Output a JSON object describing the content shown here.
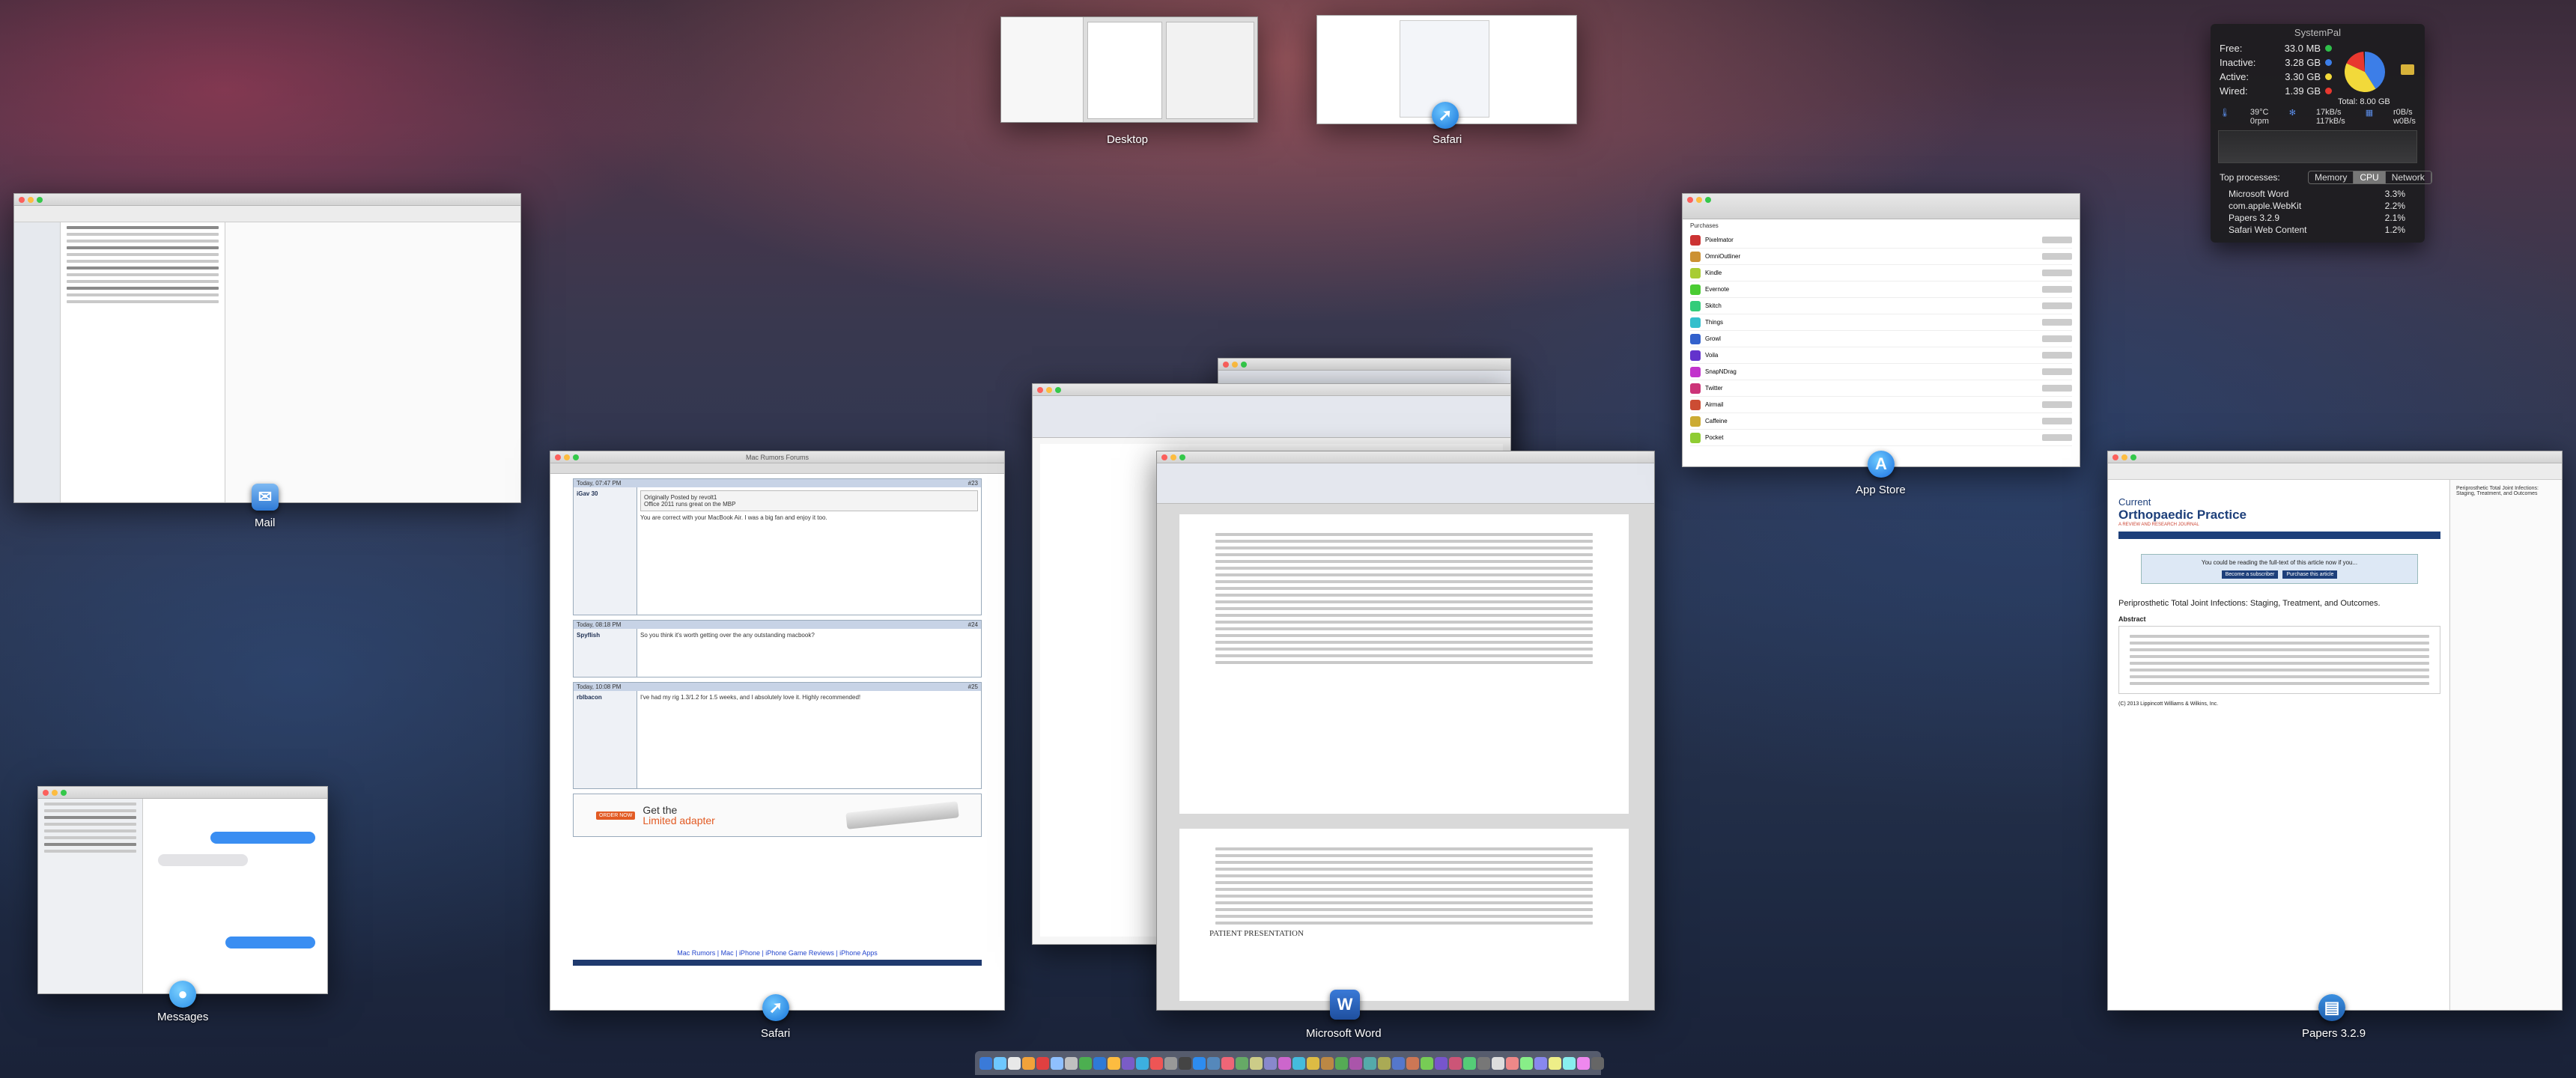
{
  "spaces": [
    {
      "label": "Desktop"
    },
    {
      "label": "Safari"
    }
  ],
  "windows": {
    "mail": {
      "app_label": "Mail"
    },
    "messages": {
      "app_label": "Messages"
    },
    "safari": {
      "app_label": "Safari",
      "title": "Mac Rumors Forums",
      "posts": [
        {
          "meta": "Today, 07:47 PM",
          "num": "#23",
          "user": "iGav 30",
          "quote_intro": "Originally Posted by revolt1",
          "quote_text": "Office 2011 runs great on the MBP",
          "body": "You are correct with your MacBook Air. I was a big fan and enjoy it too."
        },
        {
          "meta": "Today, 08:18 PM",
          "num": "#24",
          "user": "Spyflish",
          "body": "So you think it's worth getting over the any outstanding macbook?"
        },
        {
          "meta": "Today, 10:08 PM",
          "num": "#25",
          "user": "rblbacon",
          "body": "I've had my rig 1.3/1.2 for 1.5 weeks, and I absolutely love it. Highly recommended!"
        }
      ],
      "ad_text": "Get the",
      "ad_text2": "Limited adapter",
      "footer_links": "Mac Rumors | Mac | iPhone | iPhone Game Reviews | iPhone Apps"
    },
    "appstore": {
      "app_label": "App Store",
      "section": "Purchases",
      "items": [
        "Pixelmator",
        "OmniOutliner",
        "Kindle",
        "Evernote",
        "Skitch",
        "Things",
        "Growl",
        "Voila",
        "SnapNDrag",
        "Twitter",
        "Airmail",
        "Caffeine",
        "Pocket"
      ]
    },
    "word": {
      "app_label": "Microsoft Word",
      "doc_heading": "PATIENT PRESENTATION"
    },
    "papers": {
      "app_label": "Papers 3.2.9",
      "journal_title": "Current",
      "journal_subtitle": "Orthopaedic Practice",
      "journal_tagline": "A REVIEW AND RESEARCH JOURNAL",
      "access_notice": "You could be reading the full-text of this article now if you...",
      "btn_subscribe": "Become a subscriber",
      "btn_purchase": "Purchase this article",
      "article_title": "Periprosthetic Total Joint Infections: Staging, Treatment, and Outcomes.",
      "abstract_heading": "Abstract",
      "copyright": "(C) 2013 Lippincott Williams & Wilkins, Inc.",
      "side_title": "Periprosthetic Total Joint Infections: Staging, Treatment, and Outcomes"
    }
  },
  "systempal": {
    "title": "SystemPal",
    "memory": [
      {
        "label": "Free:",
        "value": "33.0 MB",
        "color": "#2fbf4a"
      },
      {
        "label": "Inactive:",
        "value": "3.28 GB",
        "color": "#3c7ee8"
      },
      {
        "label": "Active:",
        "value": "3.30 GB",
        "color": "#f2d93a"
      },
      {
        "label": "Wired:",
        "value": "1.39 GB",
        "color": "#e8382f"
      }
    ],
    "total": "Total: 8.00 GB",
    "temp": "39°C",
    "rpm": "0rpm",
    "disk_read": "17kB/s",
    "disk_write": "117kB/s",
    "net_in": "r0B/s",
    "net_out": "w0B/s",
    "top_label": "Top processes:",
    "tabs": [
      "Memory",
      "CPU",
      "Network"
    ],
    "active_tab": "CPU",
    "processes": [
      {
        "name": "Microsoft Word",
        "pct": "3.3%"
      },
      {
        "name": "com.apple.WebKit",
        "pct": "2.2%"
      },
      {
        "name": "Papers 3.2.9",
        "pct": "2.1%"
      },
      {
        "name": "Safari Web Content",
        "pct": "1.2%"
      }
    ],
    "pie_fractions": [
      0.0,
      0.41,
      0.41,
      0.17
    ]
  }
}
